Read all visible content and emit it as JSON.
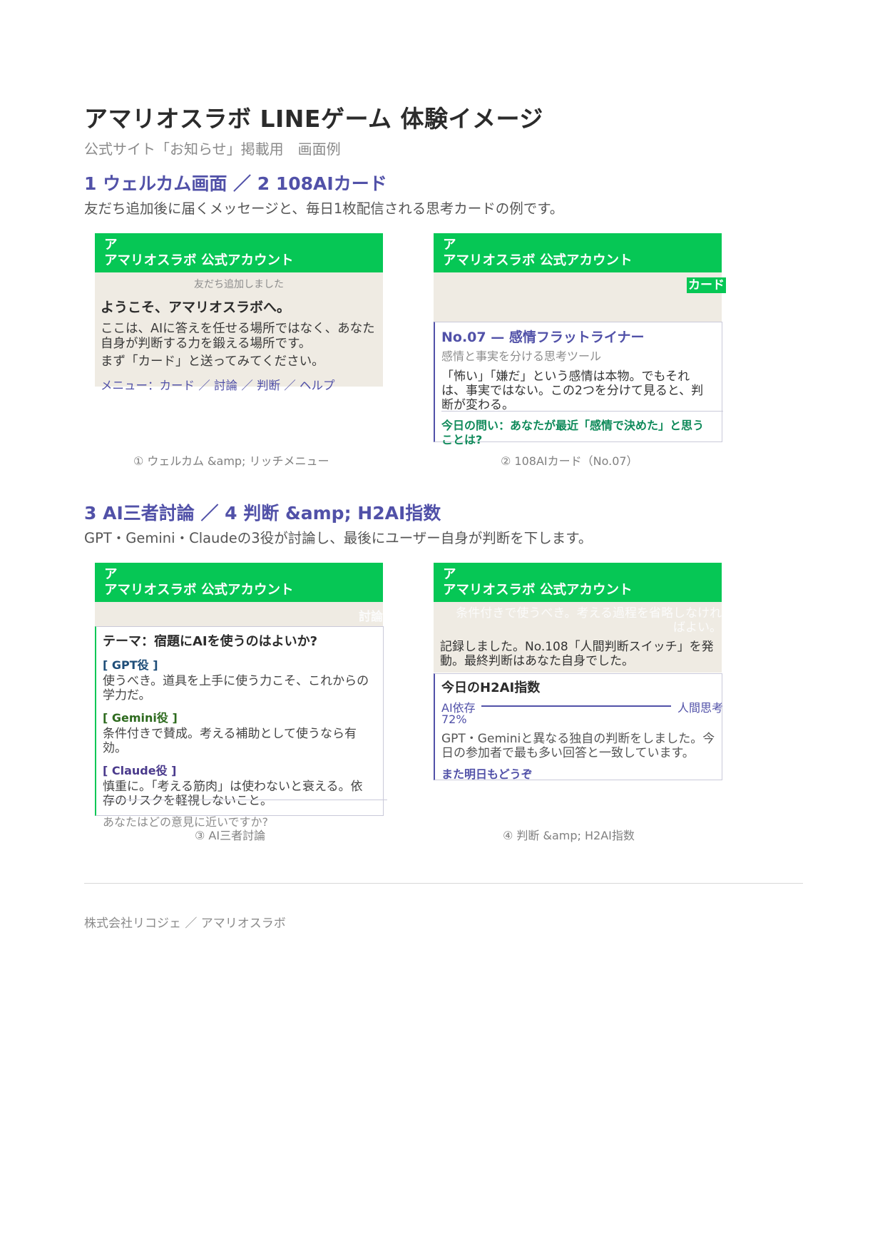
{
  "document": {
    "title": "アマリオスラボ LINEゲーム 体験イメージ",
    "subtitle": "公式サイト「お知らせ」掲載用　画面例",
    "footer": "株式会社リコジェ ／ アマリオスラボ"
  },
  "sections": [
    {
      "heading": "1 ウェルカム画面 ／ 2 108AIカード",
      "description": "友だち追加後に届くメッセージと、毎日1枚配信される思考カードの例です。"
    },
    {
      "heading": "3 AI三者討論 ／ 4 判断 &amp; H2AI指数",
      "description": "GPT・Gemini・Claudeの3役が討論し、最後にユーザー自身が判断を下します。"
    }
  ],
  "phone_header": {
    "avatar_char": "ア",
    "account_name": "アマリオスラボ 公式アカウント"
  },
  "screens": {
    "welcome": {
      "system_message": "友だち追加しました",
      "greeting": "ようこそ、アマリオスラボへ。",
      "body_line1": "ここは、AIに答えを任せる場所ではなく、あなた",
      "body_line2": "自身が判断する力を鍛える場所です。",
      "body_line3": "まず「カード」と送ってみてください。",
      "menu": "メニュー：カード ／ 討論 ／ 判断 ／ ヘルプ",
      "caption": "① ウェルカム &amp; リッチメニュー"
    },
    "card": {
      "user_message": "カード",
      "title": "No.07 — 感情フラットライナー",
      "subtitle": "感情と事実を分ける思考ツール",
      "body_line1": "「怖い」「嫌だ」という感情は本物。でもそれ",
      "body_line2": "は、事実ではない。この2つを分けて見ると、判",
      "body_line3": "断が変わる。",
      "question_line1": "今日の問い：あなたが最近「感情で決めた」と思う",
      "question_line2": "ことは?",
      "caption": "② 108AIカード（No.07）"
    },
    "debate": {
      "user_message": "討論",
      "theme": "テーマ：宿題にAIを使うのはよいか?",
      "roles": [
        {
          "label": "[ GPT役 ]",
          "color": "#1f4e79",
          "line1": "使うべき。道具を上手に使う力こそ、これからの",
          "line2": "学力だ。"
        },
        {
          "label": "[ Gemini役 ]",
          "color": "#2e6b1f",
          "line1": "条件付きで賛成。考える補助として使うなら有",
          "line2": "効。"
        },
        {
          "label": "[ Claude役 ]",
          "color": "#4a3a8c",
          "line1": "慎重に。「考える筋肉」は使わないと衰える。依",
          "line2": "存のリスクを軽視しないこと。"
        }
      ],
      "question": "あなたはどの意見に近いですか?",
      "caption": "③ AI三者討論"
    },
    "judgment": {
      "user_message_line1": "条件付きで使うべき。考える過程を省略しなけれ",
      "user_message_line2": "ばよい。",
      "reply_line1": "記録しました。No.108「人間判断スイッチ」を発",
      "reply_line2": "動。最終判断はあなた自身でした。",
      "index_title": "今日のH2AI指数",
      "scale_left": "AI依存",
      "scale_right": "人間思考",
      "index_value": "72%",
      "text_line1": "GPT・Geminiと異なる独自の判断をしました。今",
      "text_line2": "日の参加者で最も多い回答と一致しています。",
      "closing": "また明日もどうぞ",
      "caption": "④ 判断 &amp; H2AI指数"
    }
  },
  "colors": {
    "line_green": "#06c755",
    "accent_purple": "#5151a8",
    "chat_background": "#efebe3"
  }
}
